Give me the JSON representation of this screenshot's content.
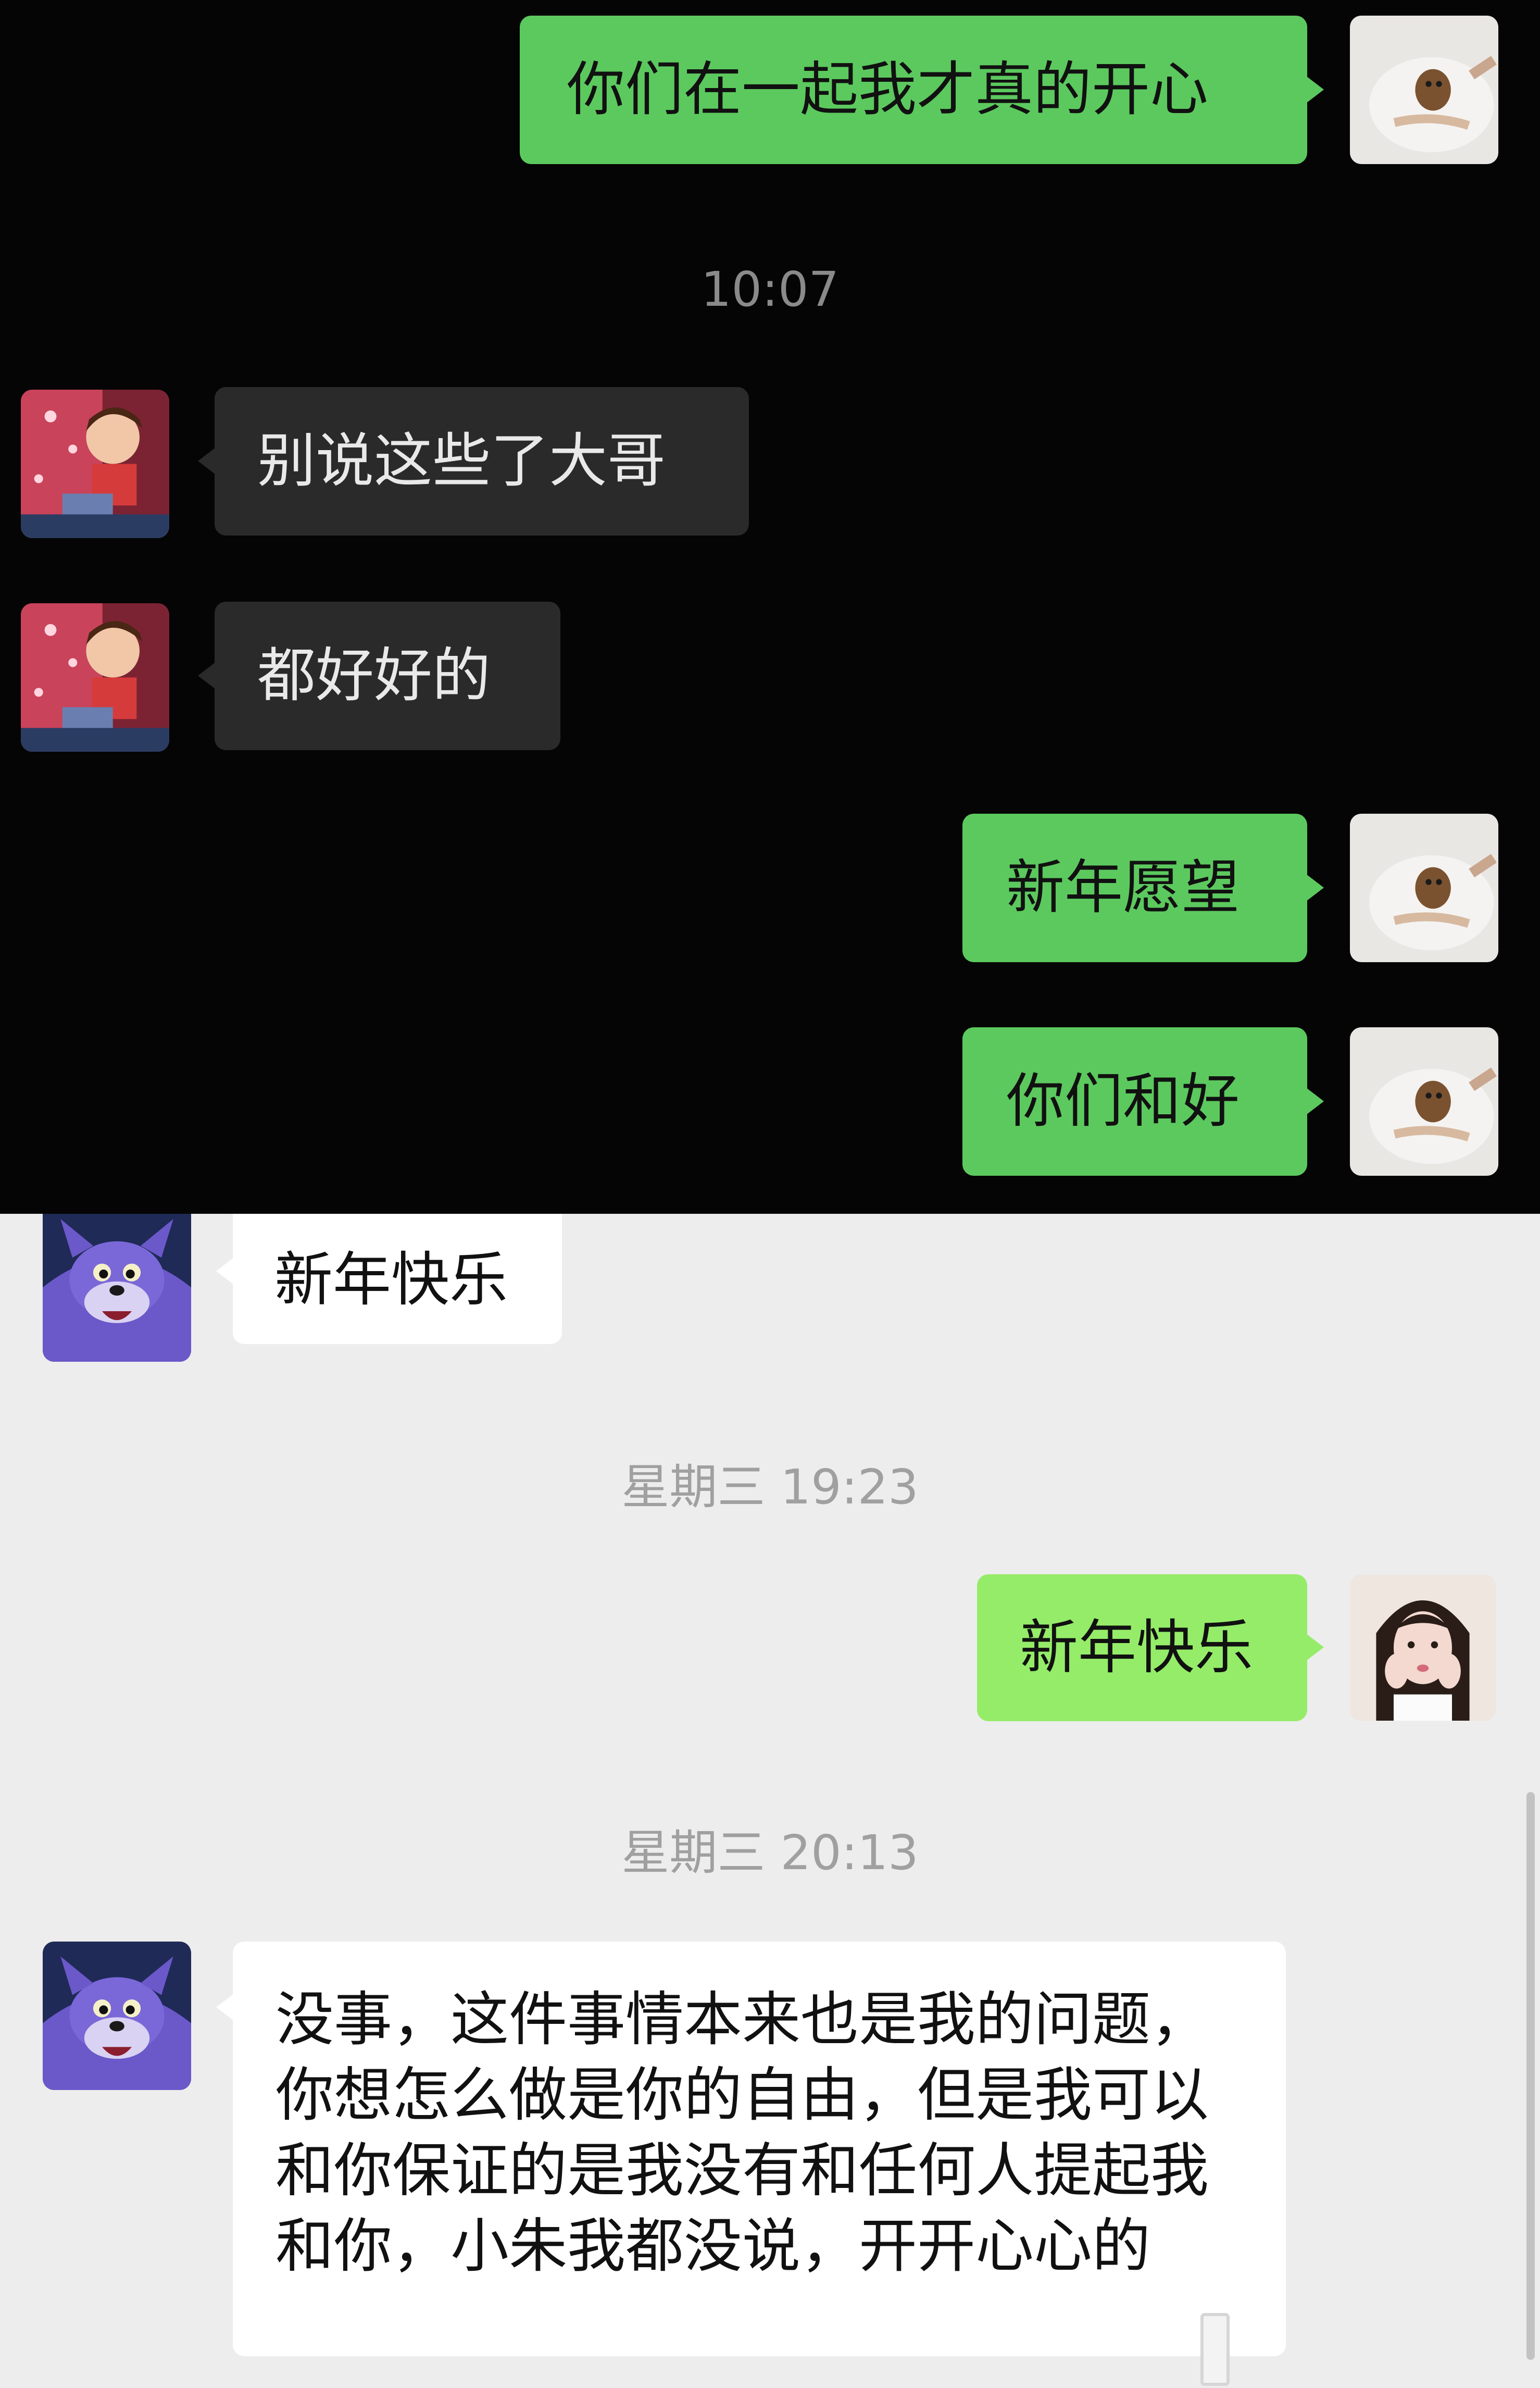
{
  "dark_section": {
    "messages": [
      {
        "side": "out",
        "text": "你们在一起我才真的开心",
        "avatar_icon": "pet-photo-avatar-icon"
      },
      {
        "side": "in",
        "text": "别说这些了大哥",
        "avatar_icon": "cartoon-boy-avatar-icon"
      },
      {
        "side": "in",
        "text": "都好好的",
        "avatar_icon": "cartoon-boy-avatar-icon"
      },
      {
        "side": "out",
        "text": "新年愿望",
        "avatar_icon": "pet-photo-avatar-icon"
      },
      {
        "side": "out",
        "text": "你们和好",
        "avatar_icon": "pet-photo-avatar-icon"
      }
    ],
    "timestamp": "10:07"
  },
  "light_section": {
    "messages": [
      {
        "side": "in",
        "text": "新年快乐",
        "avatar_icon": "cartoon-cat-avatar-icon"
      },
      {
        "side": "out",
        "text": "新年快乐",
        "avatar_icon": "girl-photo-avatar-icon"
      },
      {
        "side": "in",
        "text": "没事，这件事情本来也是我的问题，你想怎么做是你的自由，但是我可以和你保证的是我没有和任何人提起我和你，小朱我都没说，开开心心的",
        "avatar_icon": "cartoon-cat-avatar-icon"
      }
    ],
    "timestamps": [
      "星期三 19:23",
      "星期三 20:13"
    ]
  },
  "colors": {
    "dark_background": "#050505",
    "dark_out_bubble": "#5cc95e",
    "dark_in_bubble": "#2a2a2a",
    "light_background": "#ededed",
    "light_out_bubble": "#95ec69",
    "light_in_bubble": "#ffffff"
  }
}
